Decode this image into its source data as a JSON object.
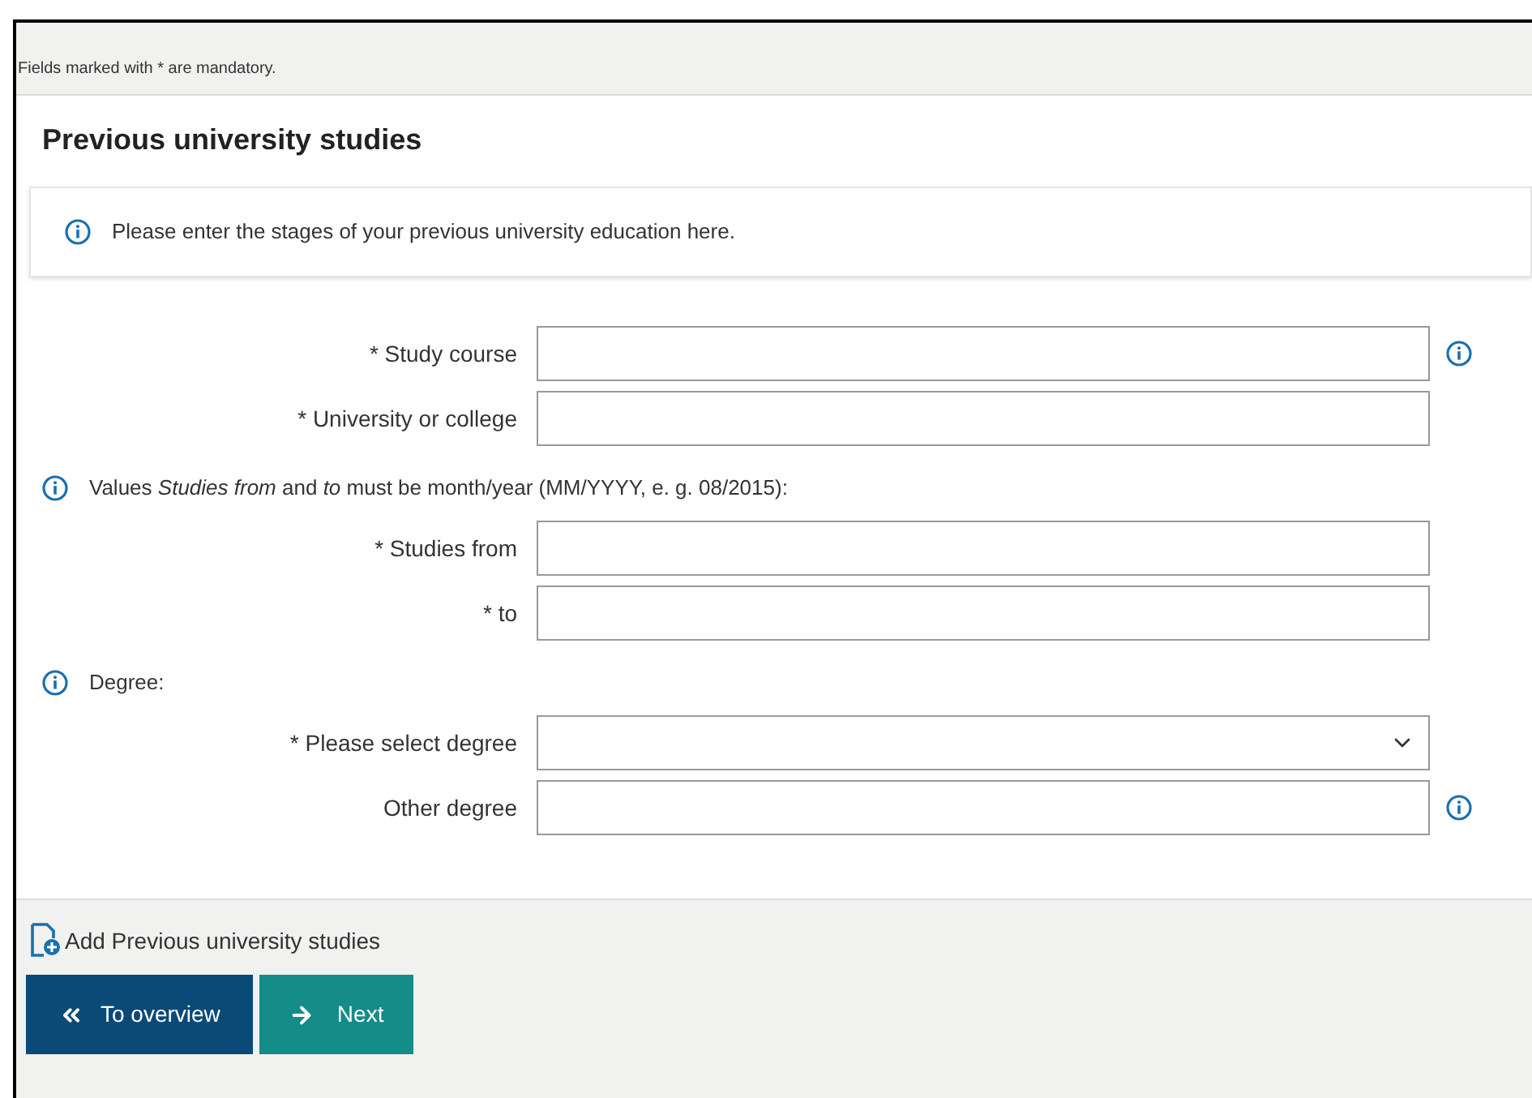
{
  "mandatory_note": "Fields marked with * are mandatory.",
  "section": {
    "title": "Previous university studies",
    "info": "Please enter the stages of your previous university education here.",
    "groups": [
      {
        "fields": [
          {
            "kind": "text",
            "label": "* Study course",
            "info_icon": true
          },
          {
            "kind": "text",
            "label": "* University or college",
            "info_icon": false
          }
        ]
      },
      {
        "hint": "Values *Studies from* and *to* must be month/year (MM/YYYY, e. g. 08/2015):",
        "fields": [
          {
            "kind": "text",
            "label": "* Studies from",
            "info_icon": false
          },
          {
            "kind": "text",
            "label": "* to",
            "info_icon": false
          }
        ]
      },
      {
        "hint": "Degree:",
        "fields": [
          {
            "kind": "select",
            "label": "* Please select degree",
            "info_icon": false
          },
          {
            "kind": "text",
            "label": "Other degree",
            "info_icon": true
          }
        ]
      }
    ]
  },
  "add_link": "Add Previous university studies",
  "buttons": [
    {
      "kind": "back",
      "label": "To overview"
    },
    {
      "kind": "next",
      "label": "Next"
    }
  ]
}
